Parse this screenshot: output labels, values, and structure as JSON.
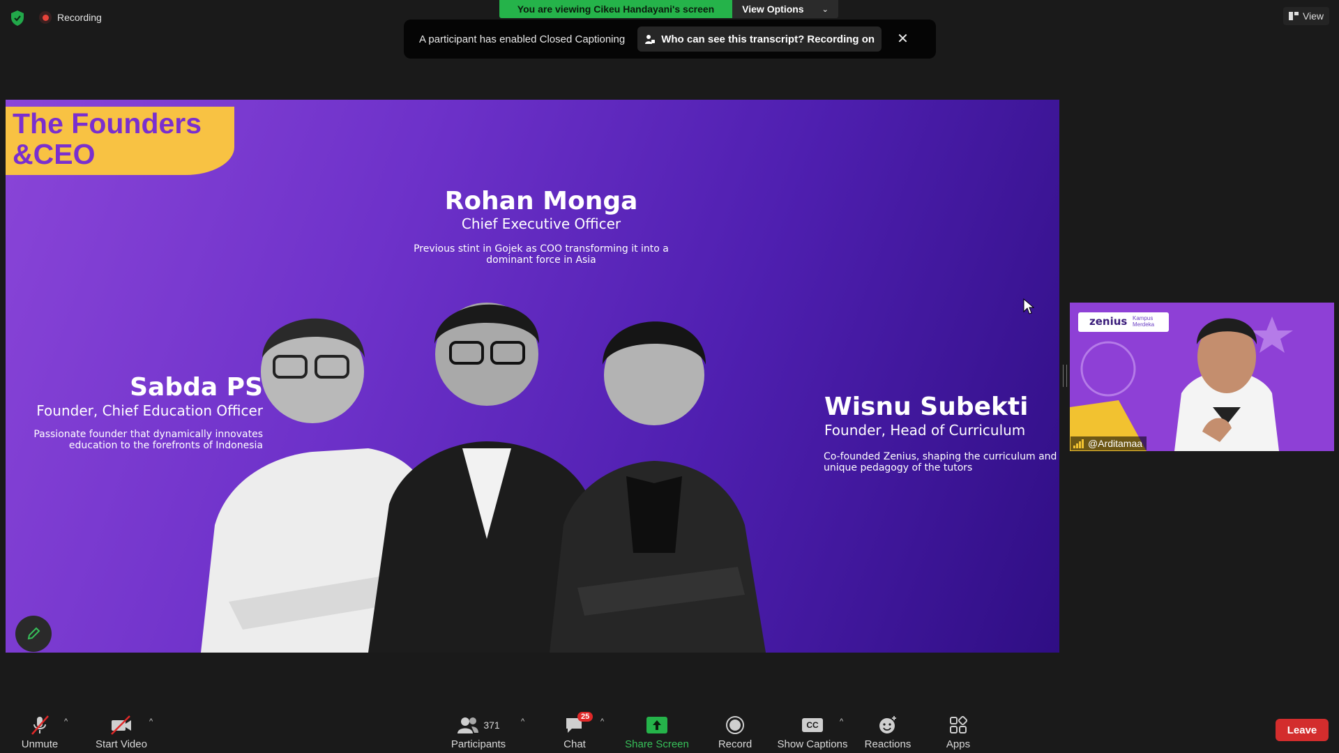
{
  "status": {
    "recording_label": "Recording"
  },
  "banner": {
    "viewing_text": "You are viewing Cikeu Handayani's screen",
    "view_options_label": "View Options"
  },
  "caption_toast": {
    "message": "A participant has enabled Closed Captioning",
    "transcript_label": "Who can see this transcript? Recording on",
    "close_glyph": "✕"
  },
  "view_button": {
    "label": "View"
  },
  "slide": {
    "title": "The Founders &CEO",
    "people": [
      {
        "name": "Rohan Monga",
        "role": "Chief Executive Officer",
        "desc": "Previous stint in Gojek as COO transforming it into a dominant force in Asia"
      },
      {
        "name": "Sabda PS",
        "role": "Founder, Chief Education Officer",
        "desc": "Passionate founder that dynamically innovates education to the forefronts of Indonesia"
      },
      {
        "name": "Wisnu Subekti",
        "role": "Founder, Head of Curriculum",
        "desc": "Co-founded Zenius, shaping the curriculum and unique pedagogy of the tutors"
      }
    ]
  },
  "thumbnail": {
    "participant_name": "@Arditamaa",
    "logo_text": "zenius",
    "logo_sub": "Kampus Merdeka"
  },
  "toolbar": {
    "unmute": "Unmute",
    "start_video": "Start Video",
    "participants": "Participants",
    "participants_count": "371",
    "chat": "Chat",
    "chat_badge": "25",
    "share_screen": "Share Screen",
    "record": "Record",
    "show_captions": "Show Captions",
    "captions_icon_text": "CC",
    "reactions": "Reactions",
    "apps": "Apps",
    "leave": "Leave"
  },
  "colors": {
    "share_green": "#25b34a",
    "leave_red": "#d32d2d",
    "slide_purple": "#6d31c9",
    "banner_yellow": "#f8c243"
  }
}
